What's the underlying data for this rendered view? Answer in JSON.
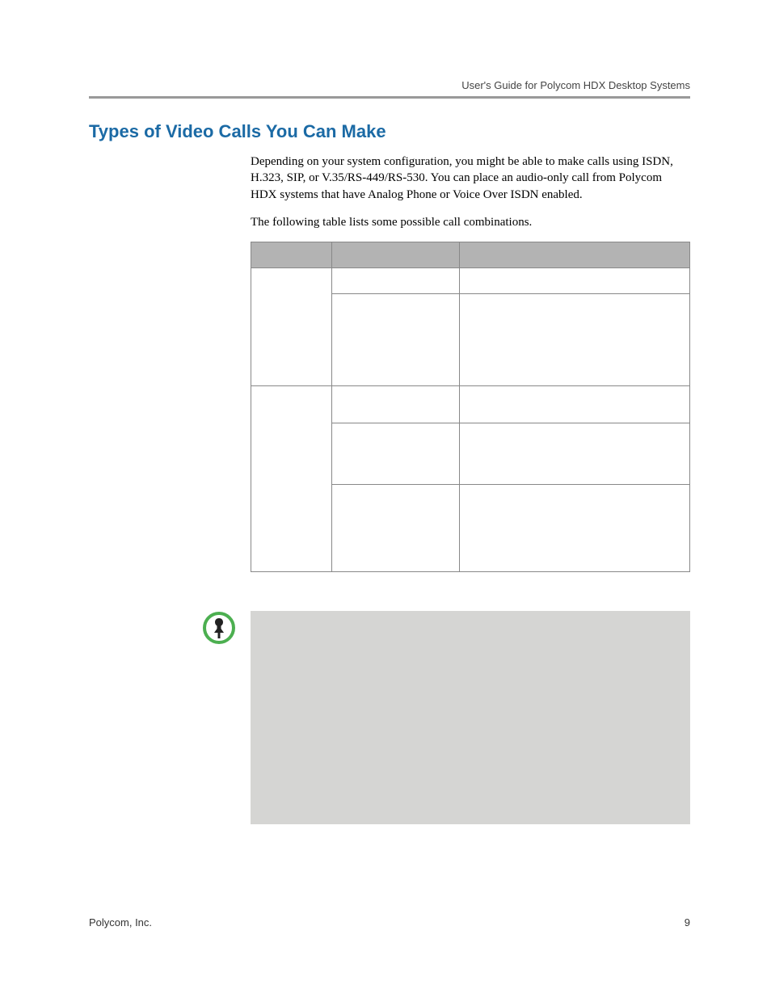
{
  "header": {
    "guide_title": "User's Guide for Polycom HDX Desktop Systems"
  },
  "section": {
    "title": "Types of Video Calls You Can Make",
    "para1": "Depending on your system configuration, you might be able to make calls using ISDN, H.323, SIP, or V.35/RS-449/RS-530. You can place an audio-only call from Polycom HDX systems that have Analog Phone or Voice Over ISDN enabled.",
    "para2": "The following table lists some possible call combinations."
  },
  "footer": {
    "company": "Polycom, Inc.",
    "page_number": "9"
  }
}
